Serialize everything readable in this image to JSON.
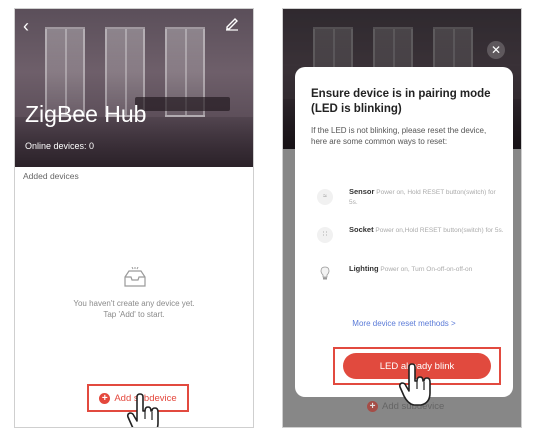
{
  "left_screen": {
    "title": "ZigBee Hub",
    "online_devices": "Online devices: 0",
    "section_label": "Added devices",
    "empty_line1": "You haven't create any device yet.",
    "empty_line2": "Tap 'Add' to start.",
    "add_button": "Add subdevice",
    "icons": [
      "back-icon",
      "edit-icon",
      "empty-inbox-icon",
      "plus-circle-icon",
      "hand-cursor-icon"
    ]
  },
  "right_screen": {
    "dialog_title": "Ensure device is in pairing mode (LED is blinking)",
    "dialog_subtitle": "If the LED is not blinking, please reset the device, here are some common ways to reset:",
    "reset_methods": [
      {
        "name": "Sensor",
        "instruction": "Power on, Hold RESET button(switch) for 5s."
      },
      {
        "name": "Socket",
        "instruction": "Power on,Hold RESET button(switch) for 5s."
      },
      {
        "name": "Lighting",
        "instruction": "Power on, Turn On-off-on-off-on"
      }
    ],
    "more_link": "More device reset methods >",
    "confirm_button": "LED already blink",
    "ghost_add_label": "Add subdevice",
    "icons": [
      "close-icon",
      "sensor-icon",
      "socket-icon",
      "bulb-icon",
      "hand-cursor-icon"
    ]
  },
  "colors": {
    "accent": "#e4473c",
    "highlight_border": "#e24a3f",
    "link": "#5b7bd8"
  }
}
